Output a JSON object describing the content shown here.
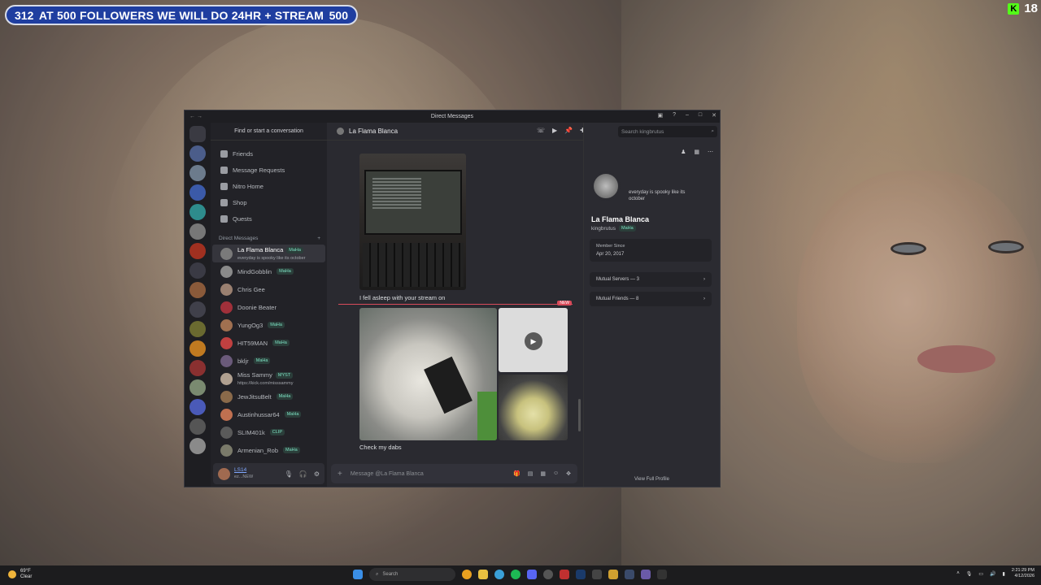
{
  "stream": {
    "count_left": "312",
    "banner_text": "AT 500 FOLLOWERS WE WILL DO 24HR + STREAM",
    "count_right": "500",
    "viewers": "18"
  },
  "window": {
    "title": "Direct Messages"
  },
  "dm_panel": {
    "search_placeholder": "Find or start a conversation",
    "menu": [
      "Friends",
      "Message Requests",
      "Nitro Home",
      "Shop",
      "Quests"
    ],
    "section_label": "Direct Messages",
    "add_symbol": "+",
    "items": [
      {
        "name": "La Flama Blanca",
        "tag": "MaHa",
        "sub": "everyday is spooky like its october",
        "active": true
      },
      {
        "name": "MindGobblin",
        "tag": "MaHa"
      },
      {
        "name": "Chris Gee",
        "tag": ""
      },
      {
        "name": "Doonie Beater",
        "tag": ""
      },
      {
        "name": "YungOg3",
        "tag": "MaHa"
      },
      {
        "name": "HIT59MAN",
        "tag": "MaHa"
      },
      {
        "name": "bkljr",
        "tag": "MaHa"
      },
      {
        "name": "Miss Sammy",
        "tag": "MYST",
        "sub": "https://kick.com/misssammy"
      },
      {
        "name": "JewJitsuBelt",
        "tag": "MaHa"
      },
      {
        "name": "Austinhussar64",
        "tag": "MaHa"
      },
      {
        "name": "SLIM401k",
        "tag": "CLIP"
      },
      {
        "name": "Armenian_Rob",
        "tag": "MaHa"
      }
    ],
    "user": {
      "name": "LS14",
      "status": "ez...NEW"
    }
  },
  "chat": {
    "header_name": "La Flama Blanca",
    "message1": "I fell asleep with your stream on",
    "new_badge": "NEW",
    "message2": "Check my dabs",
    "composer_placeholder": "Message @La Flama Blanca"
  },
  "profile": {
    "search_placeholder": "Search kingbrutus",
    "bubble": "everyday is spooky like its october",
    "display_name": "La Flama Blanca",
    "username": "kingbrutus",
    "tag": "MaHa",
    "member_since_label": "Member Since",
    "member_since": "Apr 20, 2017",
    "mutual_servers": "Mutual Servers — 3",
    "mutual_friends": "Mutual Friends — 8",
    "view_full": "View Full Profile"
  },
  "taskbar": {
    "temp": "69°F",
    "weather": "Clear",
    "search": "Search",
    "time": "2:21:29 PM",
    "date": "4/12/2026"
  },
  "colors": {
    "banner": "#1f3ea0",
    "kick_green": "#53fc18",
    "discord_bg": "#28282e",
    "new_red": "#d94b5a"
  }
}
